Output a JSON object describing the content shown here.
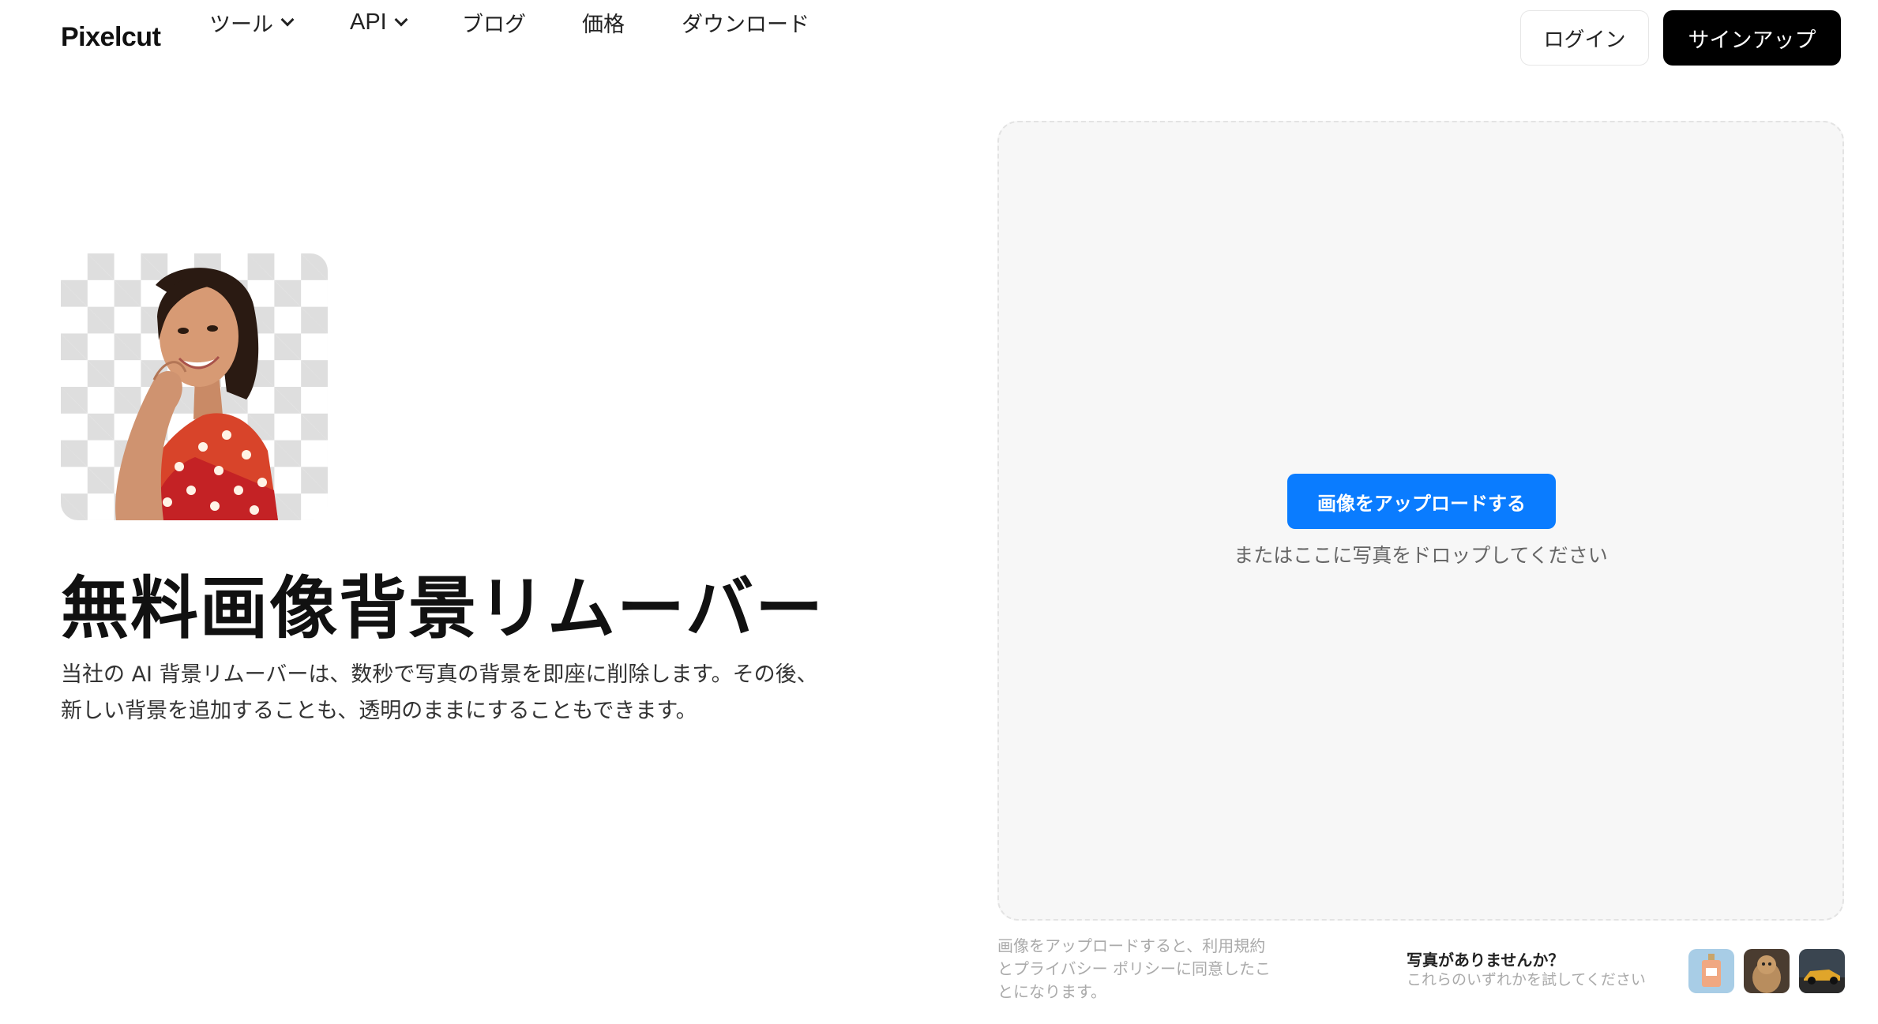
{
  "nav": {
    "logo": "Pixelcut",
    "links": [
      {
        "label": "ツール"
      },
      {
        "label": "API"
      },
      {
        "label": "ブログ"
      },
      {
        "label": "価格"
      },
      {
        "label": "ダウンロード"
      }
    ],
    "login": "ログイン",
    "signup": "サインアップ"
  },
  "hero": {
    "title": "無料画像背景リムーバー",
    "description": "当社の AI 背景リムーバーは、数秒で写真の背景を即座に削除します。その後、新しい背景を追加することも、透明のままにすることもできます。"
  },
  "upload": {
    "button": "画像をアップロードする",
    "hint": "またはここに写真をドロップしてください"
  },
  "footer": {
    "terms": "画像をアップロードすると、利用規約とプライバシー ポリシーに同意したことになります。",
    "try_title": "写真がありませんか？",
    "try_subtitle": "これらのいずれかを試してください",
    "samples": [
      "perfume-bottle",
      "dog",
      "sports-car"
    ]
  },
  "colors": {
    "accent": "#0a7cff",
    "signup_bg": "#000000",
    "dropzone_bg": "#f7f7f7"
  }
}
